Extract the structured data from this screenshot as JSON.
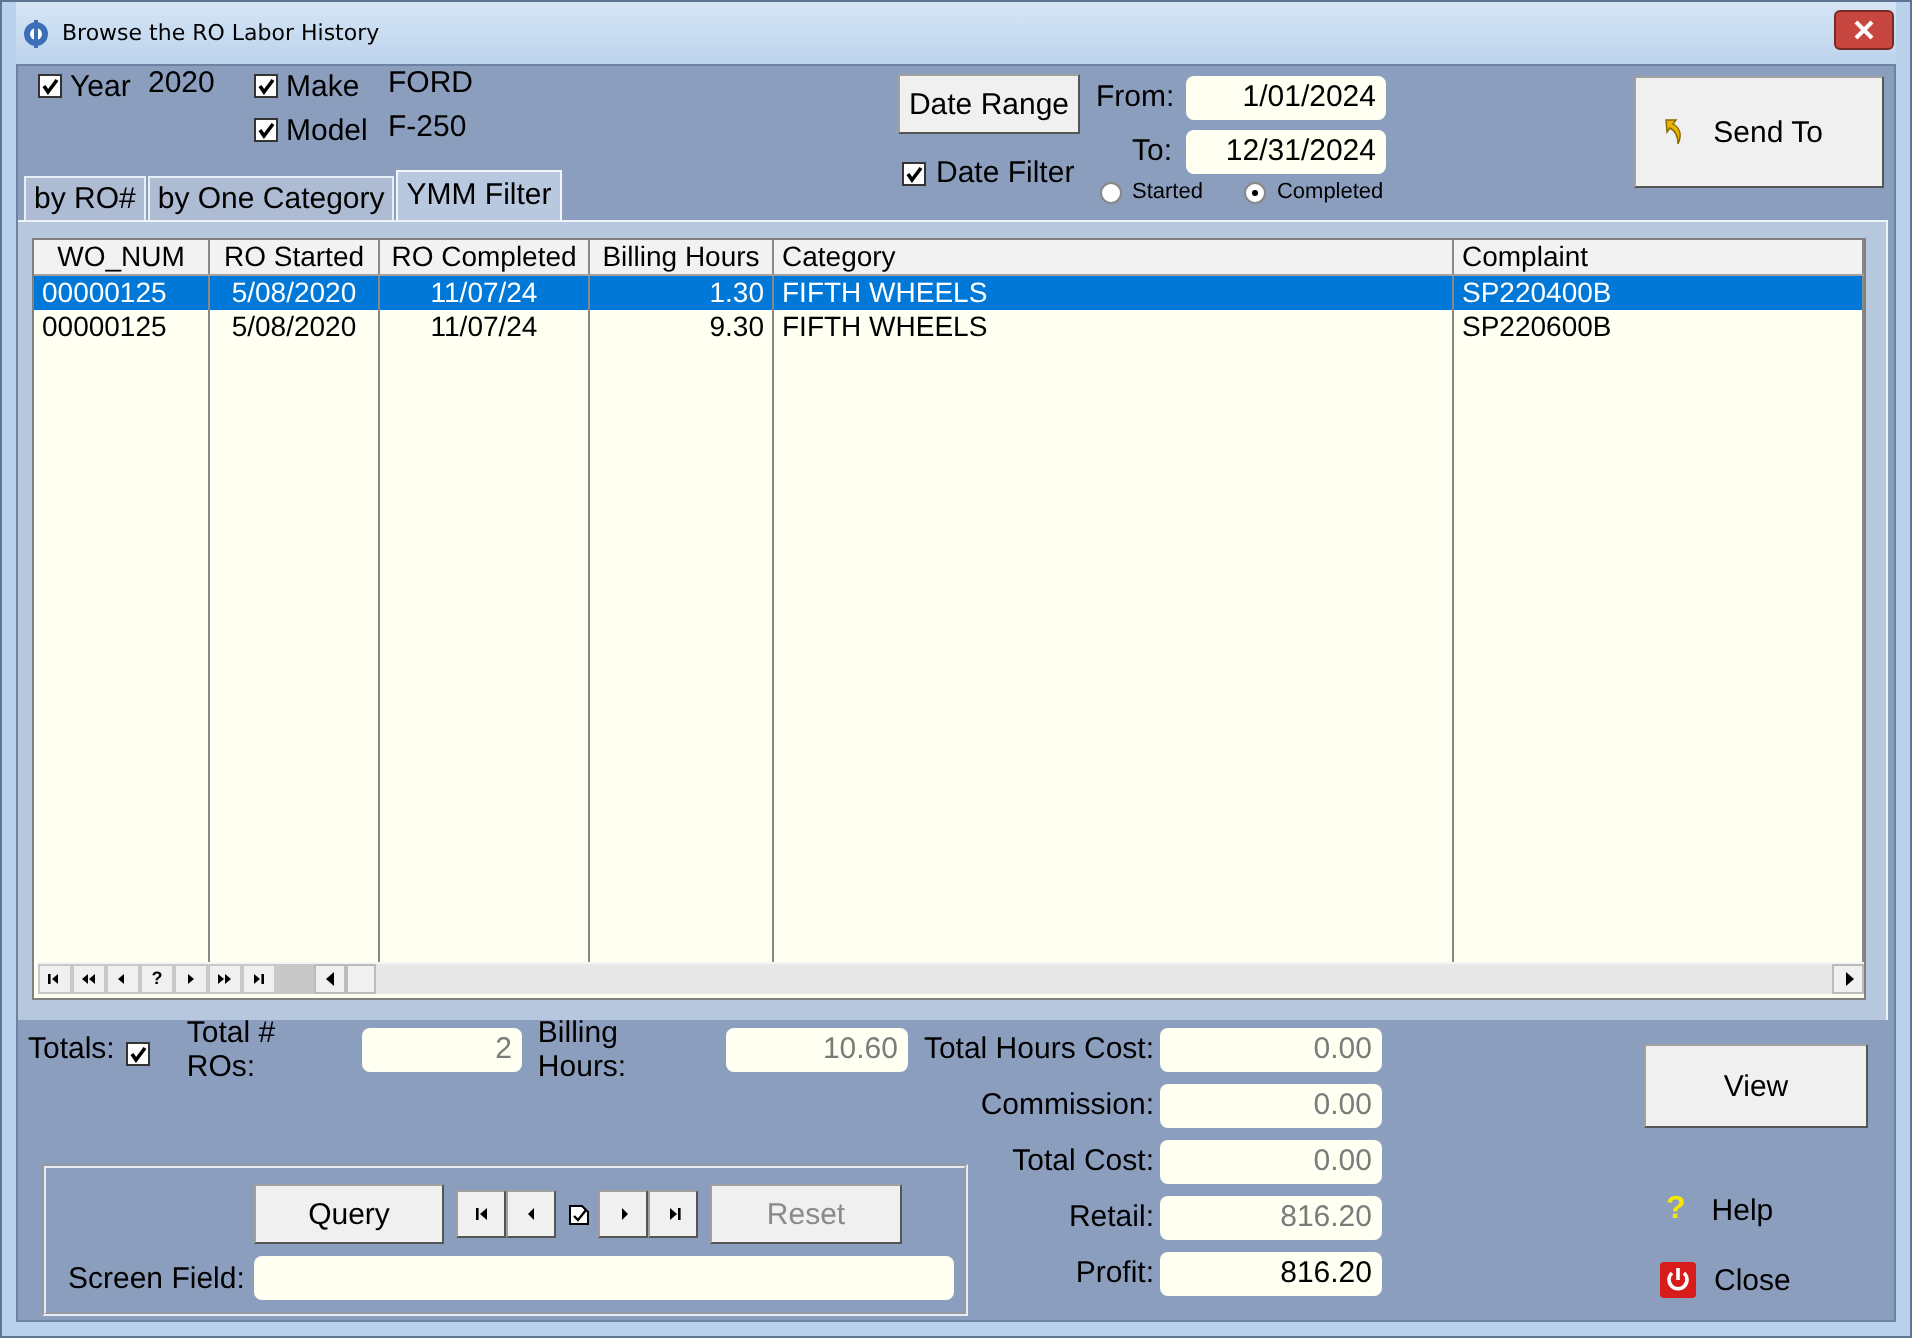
{
  "window": {
    "title": "Browse the RO Labor History"
  },
  "filters": [
    {
      "label": "Year",
      "checked": true,
      "value": "2020"
    },
    {
      "label": "Make",
      "checked": true,
      "value": "FORD"
    },
    {
      "label": "Model",
      "checked": true,
      "value": "F-250"
    }
  ],
  "date_range_button": "Date Range",
  "date_filter": {
    "label": "Date Filter",
    "checked": true
  },
  "date_fields": [
    {
      "label": "From:",
      "value": "1/01/2024"
    },
    {
      "label": "To:",
      "value": "12/31/2024"
    }
  ],
  "date_basis": [
    {
      "label": "Started",
      "selected": false
    },
    {
      "label": "Completed",
      "selected": true
    }
  ],
  "send_to_button": "Send To",
  "tabs": [
    {
      "label": "by RO#",
      "selected": false
    },
    {
      "label": "by One Category",
      "selected": false
    },
    {
      "label": "YMM Filter",
      "selected": true
    }
  ],
  "table": {
    "columns": [
      "WO_NUM",
      "RO Started",
      "RO Completed",
      "Billing Hours",
      "Category",
      "Complaint"
    ],
    "rows": [
      {
        "cells": [
          "00000125",
          "5/08/2020",
          "11/07/24",
          "1.30",
          "FIFTH WHEELS",
          "SP220400B"
        ],
        "selected": true
      },
      {
        "cells": [
          "00000125",
          "5/08/2020",
          "11/07/24",
          "9.30",
          "FIFTH WHEELS",
          "SP220600B"
        ],
        "selected": false
      }
    ],
    "navigator": {
      "find_label": "?"
    }
  },
  "totals": {
    "label": "Totals:",
    "checked": true
  },
  "summary": [
    {
      "label": "Total # ROs:",
      "value": "2",
      "disabled": true
    },
    {
      "label": "Billing Hours:",
      "value": "10.60",
      "disabled": true
    }
  ],
  "costs": [
    {
      "label": "Total Hours Cost:",
      "value": "0.00",
      "disabled": true
    },
    {
      "label": "Commission:",
      "value": "0.00",
      "disabled": true
    },
    {
      "label": "Total Cost:",
      "value": "0.00",
      "disabled": true
    },
    {
      "label": "Retail:",
      "value": "816.20",
      "disabled": true
    },
    {
      "label": "Profit:",
      "value": "816.20",
      "disabled": false
    }
  ],
  "view_button": "View",
  "help_link": {
    "icon": "?",
    "label": "Help"
  },
  "close_link": "Close",
  "query_panel": {
    "query_button": "Query",
    "reset_button": {
      "label": "Reset",
      "disabled": true
    },
    "screen_field": {
      "label": "Screen Field:"
    }
  }
}
